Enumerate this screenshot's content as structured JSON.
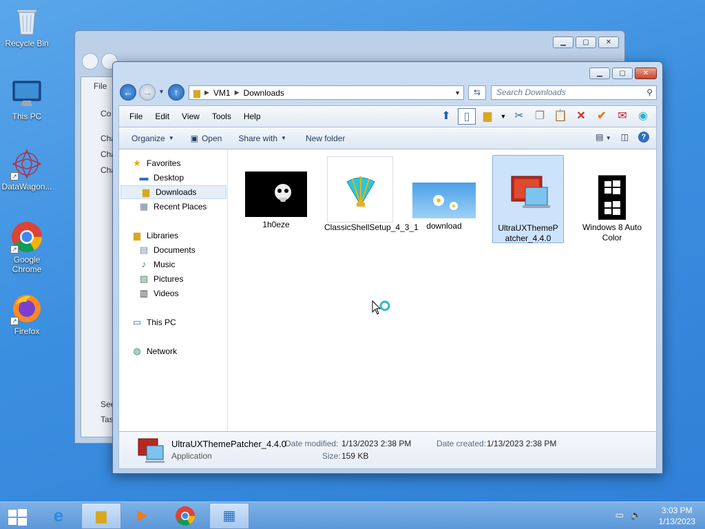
{
  "desktop": {
    "icons": [
      {
        "label": "Recycle Bin",
        "icon": "recycle-bin-icon"
      },
      {
        "label": "This PC",
        "icon": "computer-icon"
      },
      {
        "label": "DataWagon...",
        "icon": "datawagon-icon"
      },
      {
        "label": "Google Chrome",
        "icon": "chrome-icon"
      },
      {
        "label": "Firefox",
        "icon": "firefox-icon"
      }
    ]
  },
  "back_window": {
    "menu_file": "File",
    "side_items": [
      "Co",
      "Cha",
      "Cha",
      "Cha"
    ],
    "bottom_items": [
      "See",
      "Tas"
    ]
  },
  "window": {
    "address": {
      "segments": [
        "VM1",
        "Downloads"
      ]
    },
    "search_placeholder": "Search Downloads",
    "menu": [
      "File",
      "Edit",
      "View",
      "Tools",
      "Help"
    ],
    "commands": {
      "organize": "Organize",
      "open": "Open",
      "share_with": "Share with",
      "new_folder": "New folder"
    },
    "nav": {
      "favorites": "Favorites",
      "desktop": "Desktop",
      "downloads": "Downloads",
      "recent_places": "Recent Places",
      "libraries": "Libraries",
      "documents": "Documents",
      "music": "Music",
      "pictures": "Pictures",
      "videos": "Videos",
      "this_pc": "This PC",
      "network": "Network"
    },
    "files": [
      {
        "name": "1h0eze"
      },
      {
        "name": "ClassicShellSetup_4_3_1"
      },
      {
        "name": "download"
      },
      {
        "name": "UltraUXThemePatcher_4.4.0",
        "selected": true
      },
      {
        "name": "Windows 8 Auto Color"
      }
    ],
    "details": {
      "name": "UltraUXThemePatcher_4.4.0",
      "type": "Application",
      "date_modified_label": "Date modified:",
      "date_modified": "1/13/2023 2:38 PM",
      "date_created_label": "Date created:",
      "date_created": "1/13/2023 2:38 PM",
      "size_label": "Size:",
      "size": "159 KB"
    }
  },
  "taskbar": {
    "time": "3:03 PM",
    "date": "1/13/2023",
    "apps": [
      "internet-explorer-icon",
      "file-explorer-icon",
      "media-player-icon",
      "chrome-icon",
      "control-panel-icon"
    ]
  }
}
